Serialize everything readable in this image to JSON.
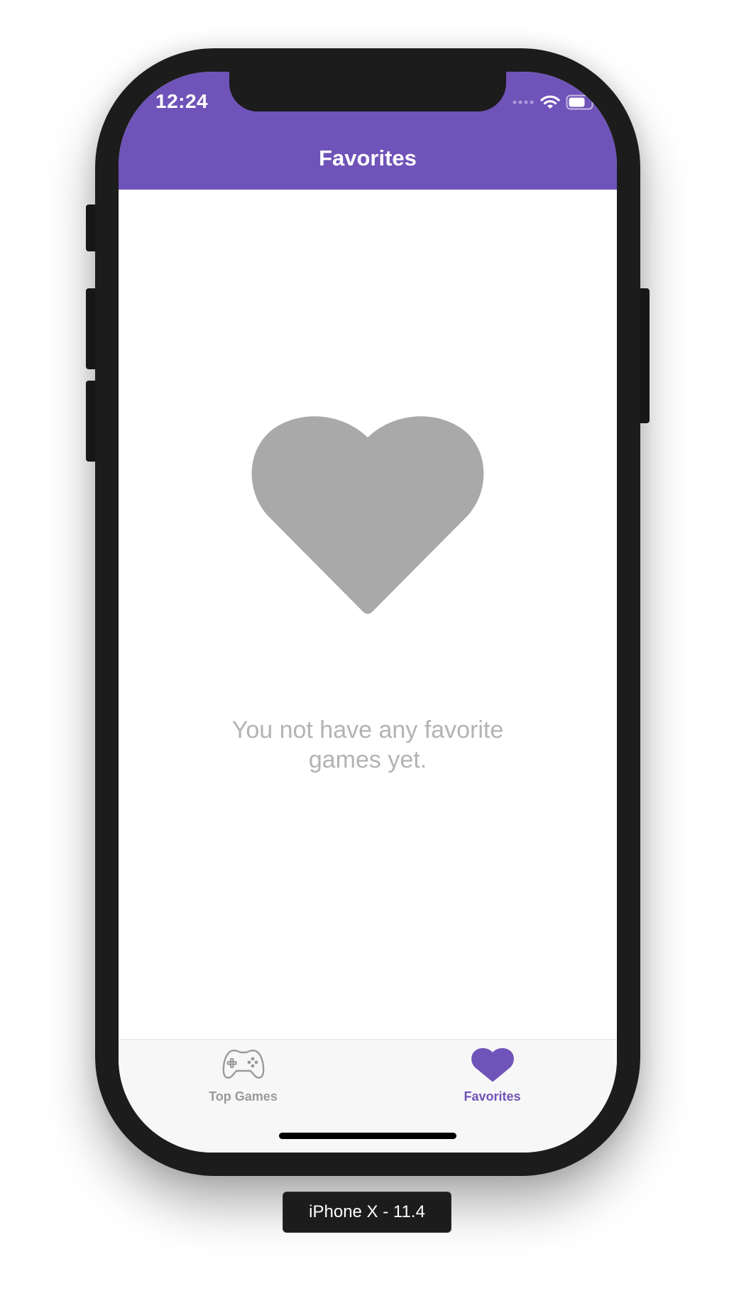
{
  "status_bar": {
    "time": "12:24",
    "wifi_icon": "wifi-icon",
    "battery_icon": "battery-icon",
    "signal_icon": "signal-dots-icon"
  },
  "nav": {
    "title": "Favorites"
  },
  "empty_state": {
    "icon": "heart-icon",
    "message": "You not have any favorite\ngames yet."
  },
  "tab_bar": {
    "tabs": [
      {
        "label": "Top Games",
        "icon": "gamepad-icon",
        "selected": false
      },
      {
        "label": "Favorites",
        "icon": "heart-icon",
        "selected": true
      }
    ]
  },
  "device": {
    "label": "iPhone X - 11.4"
  },
  "colors": {
    "accent": "#6f53b8",
    "heart_gray": "#a9a9a9",
    "text_gray": "#b3b3b3",
    "inactive_tab": "#9a9a9a"
  }
}
